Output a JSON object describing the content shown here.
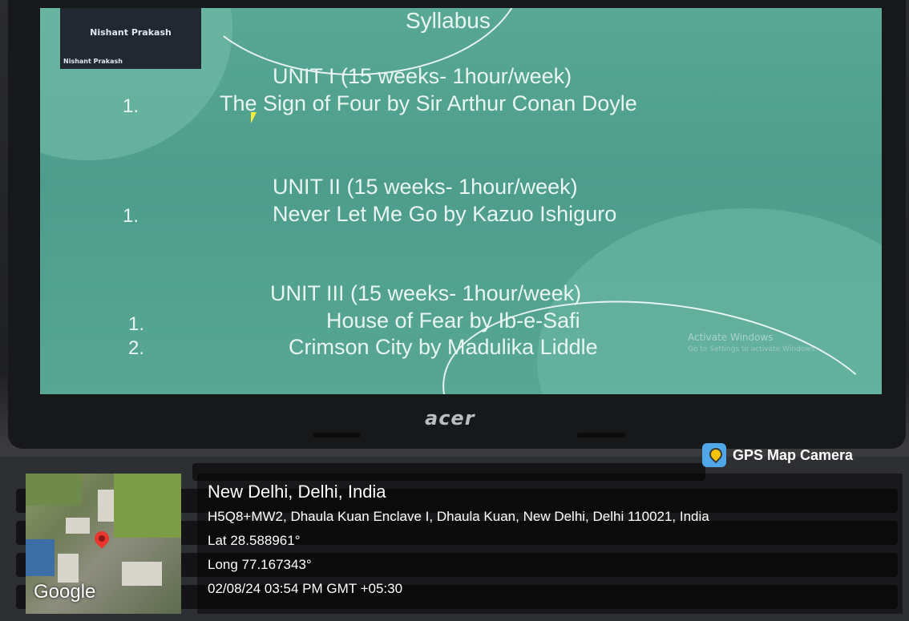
{
  "video_tile": {
    "participant_name": "Nishant Prakash",
    "label": "Nishant Prakash"
  },
  "slide": {
    "title": "Syllabus",
    "units": [
      {
        "heading": "UNIT I (15 weeks- 1hour/week)",
        "items": [
          {
            "number": "1.",
            "text": "The Sign of Four by Sir Arthur Conan Doyle"
          }
        ]
      },
      {
        "heading": "UNIT II (15 weeks- 1hour/week)",
        "items": [
          {
            "number": "1.",
            "text": "Never Let Me Go by Kazuo Ishiguro"
          }
        ]
      },
      {
        "heading": "UNIT III (15 weeks- 1hour/week)",
        "items": [
          {
            "number": "1.",
            "text": "House of Fear by Ib-e-Safi"
          },
          {
            "number": "2.",
            "text": "Crimson City by Madulika Liddle"
          }
        ]
      }
    ],
    "activation_title": "Activate Windows",
    "activation_hint": "Go to Settings to activate Windows."
  },
  "laptop": {
    "brand": "acer"
  },
  "gps_overlay": {
    "app_name": "GPS Map Camera",
    "map_label": "Google",
    "city": "New Delhi, Delhi, India",
    "address": "H5Q8+MW2, Dhaula Kuan Enclave I, Dhaula Kuan, New Delhi, Delhi 110021, India",
    "latitude": "Lat 28.588961°",
    "longitude": "Long 77.167343°",
    "datetime": "02/08/24 03:54 PM GMT +05:30"
  },
  "colors": {
    "slide_bg": "#58a895",
    "slide_text": "#e9f5f1",
    "cursor": "#f7ef3a",
    "map_pin": "#e8372d"
  }
}
